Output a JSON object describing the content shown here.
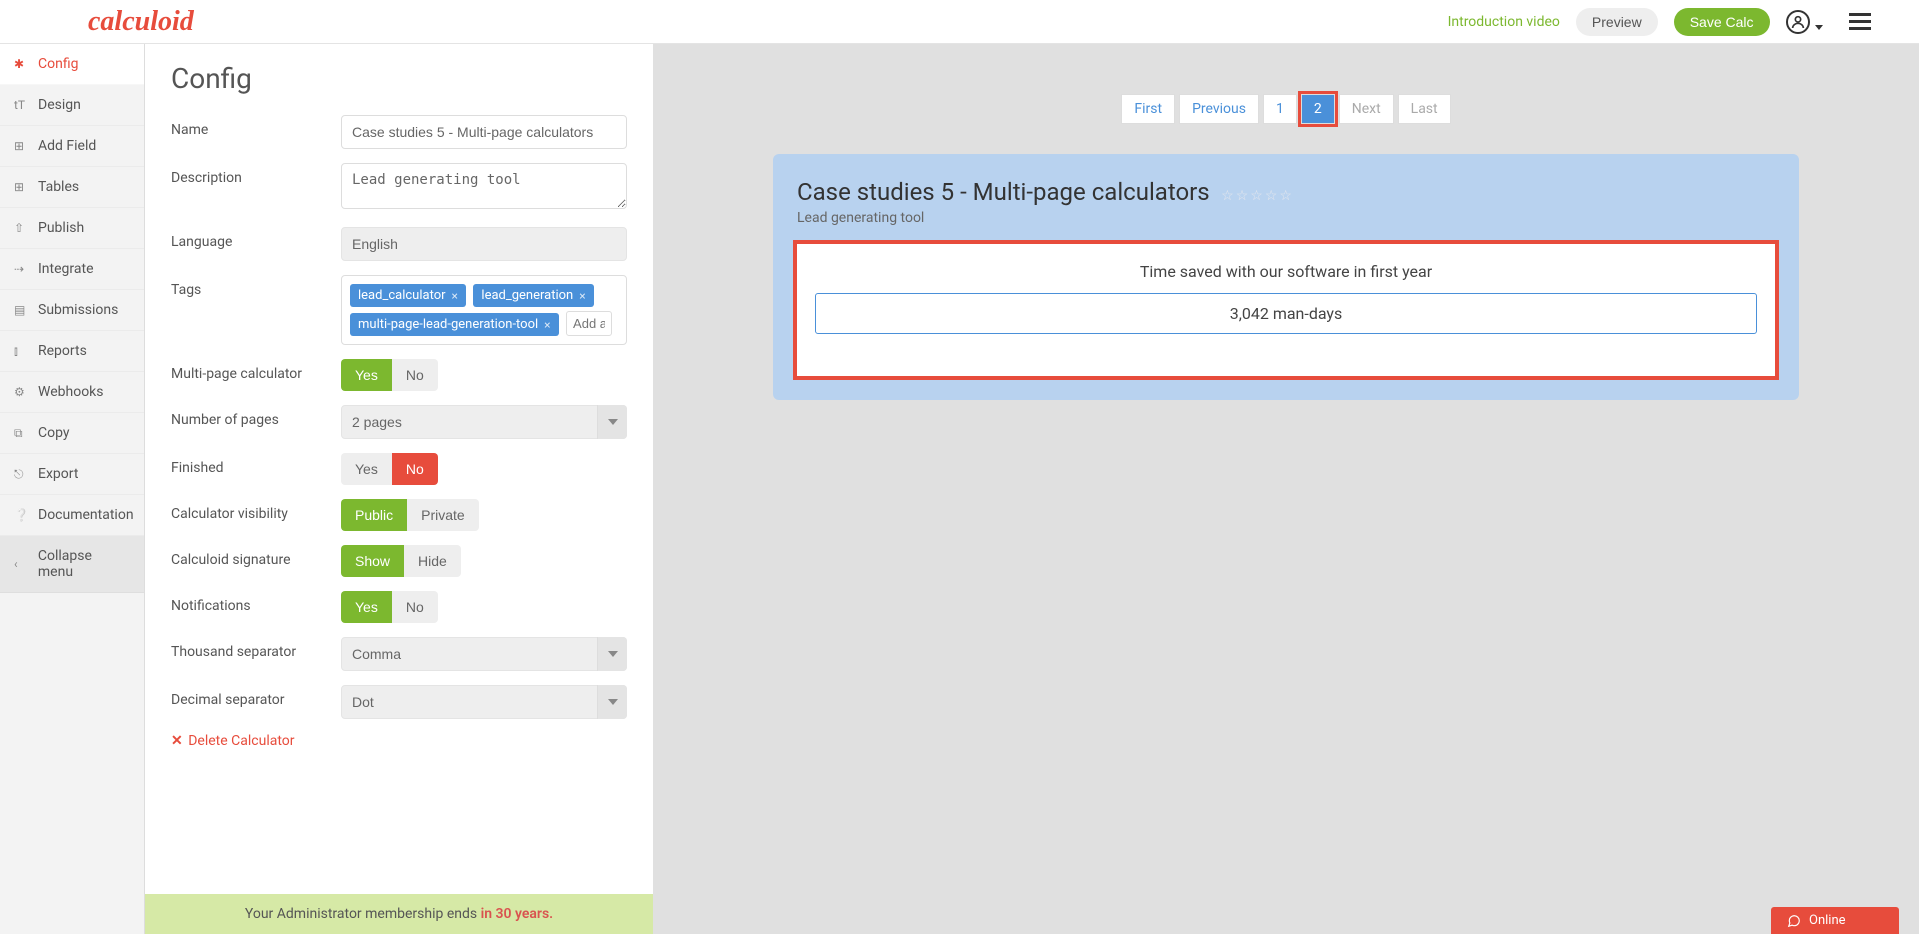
{
  "header": {
    "logo": "calculoid",
    "intro": "Introduction video",
    "preview": "Preview",
    "save": "Save Calc"
  },
  "sidebar": {
    "items": [
      {
        "label": "Config"
      },
      {
        "label": "Design"
      },
      {
        "label": "Add Field"
      },
      {
        "label": "Tables"
      },
      {
        "label": "Publish"
      },
      {
        "label": "Integrate"
      },
      {
        "label": "Submissions"
      },
      {
        "label": "Reports"
      },
      {
        "label": "Webhooks"
      },
      {
        "label": "Copy"
      },
      {
        "label": "Export"
      },
      {
        "label": "Documentation"
      },
      {
        "label": "Collapse menu"
      }
    ]
  },
  "config": {
    "title": "Config",
    "labels": {
      "name": "Name",
      "description": "Description",
      "language": "Language",
      "tags": "Tags",
      "multipage": "Multi-page calculator",
      "numpages": "Number of pages",
      "finished": "Finished",
      "visibility": "Calculator visibility",
      "signature": "Calculoid signature",
      "notifications": "Notifications",
      "thousand": "Thousand separator",
      "decimal": "Decimal separator"
    },
    "values": {
      "name": "Case studies 5 - Multi-page calculators",
      "description": "Lead generating tool",
      "language": "English",
      "numpages": "2 pages",
      "thousand": "Comma",
      "decimal": "Dot"
    },
    "tags": [
      "lead_calculator",
      "lead_generation",
      "multi-page-lead-generation-tool"
    ],
    "tag_placeholder": "Add a ta",
    "toggles": {
      "yes": "Yes",
      "no": "No",
      "public": "Public",
      "private": "Private",
      "show": "Show",
      "hide": "Hide"
    },
    "delete": "Delete Calculator"
  },
  "membership": {
    "text": "Your Administrator membership ends ",
    "years": "in 30 years."
  },
  "pagination": {
    "first": "First",
    "prev": "Previous",
    "one": "1",
    "two": "2",
    "next": "Next",
    "last": "Last"
  },
  "preview": {
    "title": "Case studies 5 - Multi-page calculators",
    "subtitle": "Lead generating tool",
    "result_label": "Time saved with our software in first year",
    "result_value": "3,042 man-days"
  },
  "chat": {
    "label": "Online"
  }
}
